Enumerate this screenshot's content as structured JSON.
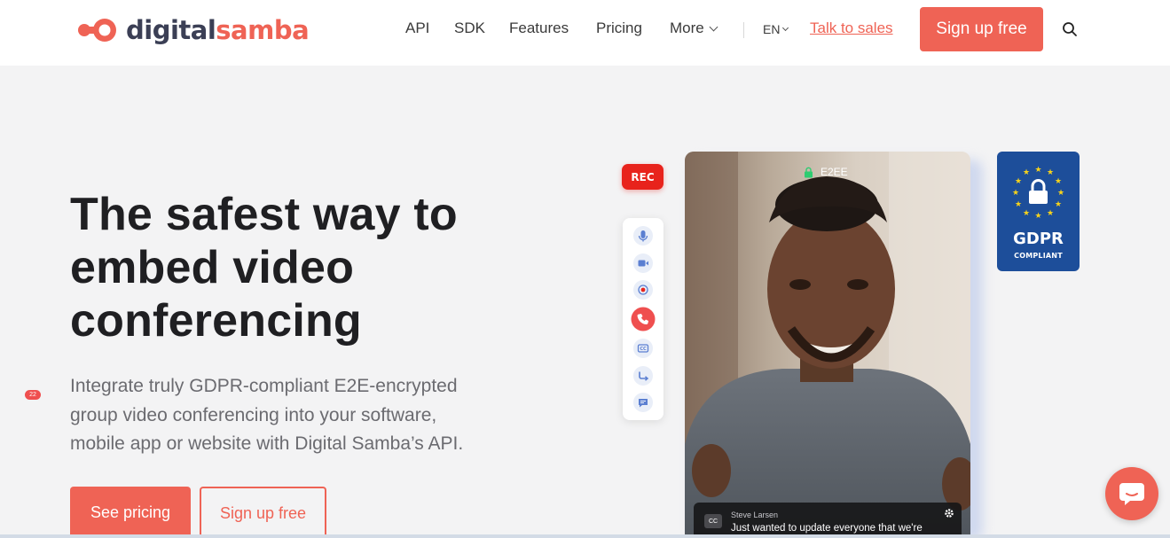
{
  "header": {
    "logo_part1": "digital",
    "logo_part2": "samba",
    "nav": [
      "API",
      "SDK",
      "Features",
      "Pricing",
      "More"
    ],
    "lang": "EN",
    "talk_to_sales": "Talk to sales",
    "signup": "Sign up free"
  },
  "hero": {
    "title_line1": "The safest way to",
    "title_line2": "embed video",
    "title_line3": "conferencing",
    "subtitle": "Integrate truly GDPR-compliant E2E-encrypted group video conferencing into your software, mobile app or website with Digital Samba’s API.",
    "btn_pricing": "See pricing",
    "btn_signup": "Sign up free"
  },
  "video": {
    "rec": "REC",
    "e2ee": "E2EE",
    "chat_badge": "22",
    "caption_cc": "CC",
    "caption_name": "Steve Larsen",
    "caption_text": "Just wanted to update everyone that we're"
  },
  "gdpr": {
    "title": "GDPR",
    "subtitle": "COMPLIANT"
  },
  "colors": {
    "brand": "#ef6355",
    "navy": "#3b3f55",
    "gdpr_blue": "#1d4e9a",
    "rec_red": "#e8231c"
  }
}
